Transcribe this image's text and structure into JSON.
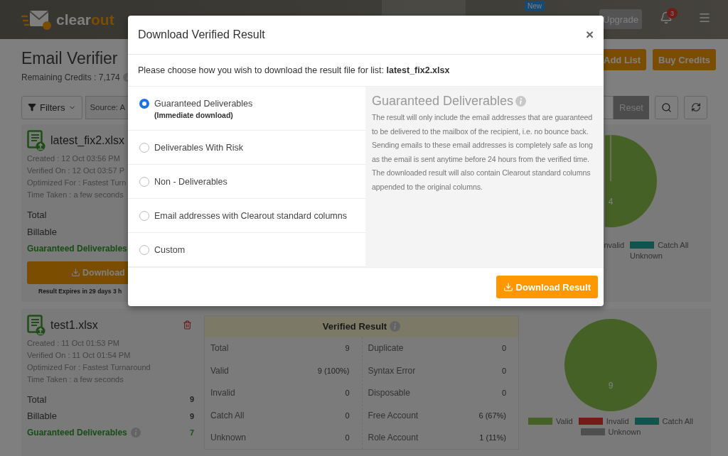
{
  "header": {
    "logo": {
      "name_start": "clear",
      "name_end": "out"
    },
    "nav_badge": "New",
    "upgrade": "Upgrade",
    "notifications": "3"
  },
  "page": {
    "title": "Email Verifier",
    "credits": "Remaining Credits : 7,174",
    "actions": [
      "Add List",
      "Buy Credits"
    ]
  },
  "filters": {
    "filters_button": "Filters",
    "source_select": "Source: A",
    "reset": "Reset"
  },
  "lists": [
    {
      "name": "latest_fix2.xlsx",
      "meta": [
        "Created : 12 Oct 03:56 PM",
        "Verified On : 12 Oct 03:57 P",
        "Optimized For : Fastest Turn",
        "Time Taken : a few seconds"
      ],
      "stats": [
        {
          "label": "Total",
          "kind": "plain"
        },
        {
          "label": "Billable",
          "kind": "plain"
        },
        {
          "label": "Guaranteed Deliverables",
          "kind": "guaranteed"
        }
      ],
      "download": "Download",
      "expiry": "Result Expires in 29 days 3 h",
      "pie": {
        "label": "4",
        "legend": [
          {
            "label": "nvalid"
          },
          {
            "label": "Catch All",
            "color": "#13534d"
          },
          {
            "label": "Unknown"
          }
        ]
      }
    },
    {
      "name": "test1.xlsx",
      "deletable": true,
      "meta": [
        "Created : 11 Oct 01:53 PM",
        "Verified On : 11 Oct 01:54 PM",
        "Optimized For : Fastest Turnaround",
        "Time Taken : a few seconds"
      ],
      "stats": [
        {
          "label": "Total",
          "value": "9",
          "kind": "plain"
        },
        {
          "label": "Billable",
          "value": "9",
          "kind": "plain"
        },
        {
          "label": "Guaranteed Deliverables",
          "value": "7",
          "kind": "guaranteed"
        }
      ],
      "result": {
        "title": "Verified Result",
        "left": [
          {
            "label": "Total",
            "value": "9"
          },
          {
            "label": "Valid",
            "value": "9 (100%)"
          },
          {
            "label": "Invalid",
            "value": "0"
          },
          {
            "label": "Catch All",
            "value": "0"
          },
          {
            "label": "Unknown",
            "value": "0"
          }
        ],
        "right": [
          {
            "label": "Duplicate",
            "value": "0"
          },
          {
            "label": "Syntax Error",
            "value": "0"
          },
          {
            "label": "Disposable",
            "value": "0"
          },
          {
            "label": "Free Account",
            "value": "6 (67%)"
          },
          {
            "label": "Role Account",
            "value": "1 (11%)"
          }
        ]
      },
      "chart_data": {
        "type": "pie",
        "categories": [
          "Valid",
          "Invalid",
          "Catch All",
          "Unknown"
        ],
        "values": [
          9,
          0,
          0,
          0
        ],
        "colors": [
          "#8bc34a",
          "#e53935",
          "#26a69a",
          "#9e9e9e"
        ],
        "data_labels": true
      }
    }
  ],
  "modal": {
    "title": "Download Verified Result",
    "close": "×",
    "prompt": "Please choose how you wish to download the result file for list: **latest_fix2.xlsx**",
    "options": [
      {
        "label": "Guaranteed Deliverables",
        "note": "(Immediate download)",
        "selected": true
      },
      {
        "label": "Deliverables With Risk",
        "selected": false
      },
      {
        "label": "Non - Deliverables",
        "selected": false
      },
      {
        "label": "Email addresses with Clearout standard columns",
        "selected": false
      },
      {
        "label": "Custom",
        "selected": false
      }
    ],
    "detail": {
      "title": "Guaranteed Deliverables",
      "text": "The result will only include the email addresses that are guaranteed to be delivered to the mailbox of the recipient, i.e. no bounce back. Sending emails to these email addresses is completely safe as long as the email is sent anytime before 24 hours from the verified time. The downloaded result will also contain Clearout standard columns appended to the original columns."
    },
    "button": "Download Result"
  }
}
